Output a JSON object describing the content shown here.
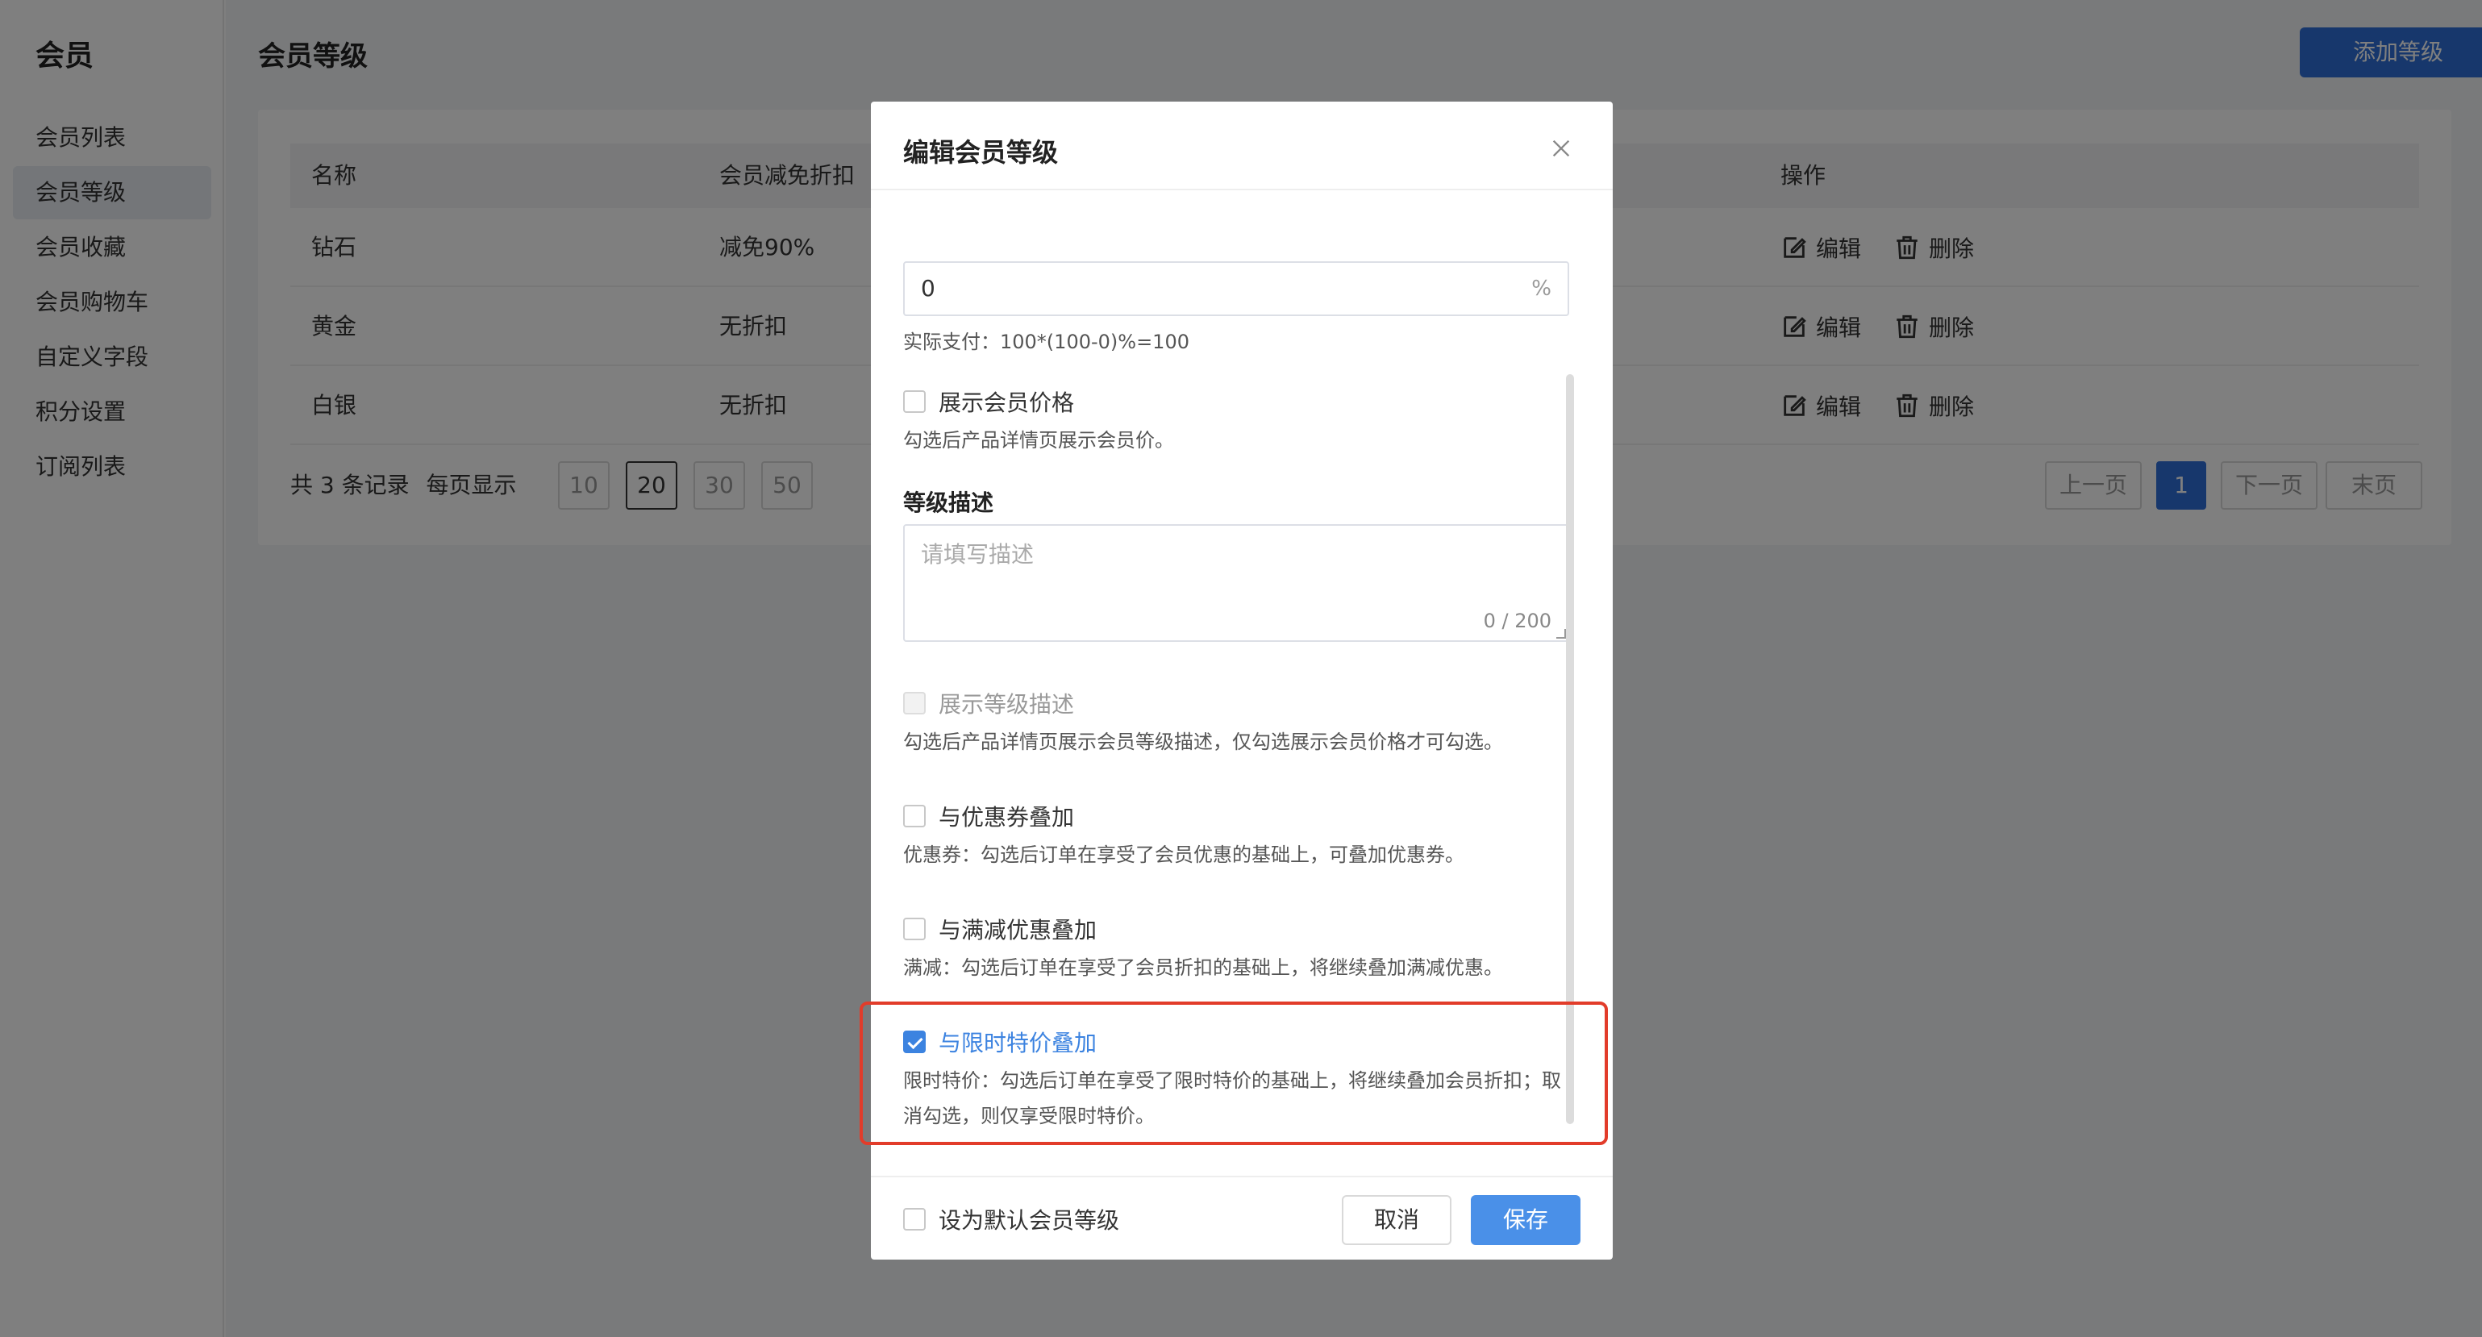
{
  "sidebar": {
    "title": "会员",
    "items": [
      {
        "label": "会员列表"
      },
      {
        "label": "会员等级",
        "active": true
      },
      {
        "label": "会员收藏"
      },
      {
        "label": "会员购物车"
      },
      {
        "label": "自定义字段"
      },
      {
        "label": "积分设置"
      },
      {
        "label": "订阅列表"
      }
    ]
  },
  "header": {
    "title": "会员等级",
    "add_button": "添加等级"
  },
  "table": {
    "columns": [
      "名称",
      "会员减免折扣",
      "操作"
    ],
    "rows": [
      {
        "name": "钻石",
        "discount": "减免90%"
      },
      {
        "name": "黄金",
        "discount": "无折扣"
      },
      {
        "name": "白银",
        "discount": "无折扣"
      }
    ],
    "edit_label": "编辑",
    "delete_label": "删除"
  },
  "pagination": {
    "total_text": "共 3 条记录",
    "per_page_label": "每页显示",
    "sizes": [
      "10",
      "20",
      "30",
      "50"
    ],
    "selected_size": "20",
    "prev": "上一页",
    "current_page": "1",
    "next": "下一页",
    "last": "末页"
  },
  "modal": {
    "title": "编辑会员等级",
    "discount_input": {
      "value": "0",
      "suffix": "%",
      "hint": "实际支付：100*(100-0)%=100"
    },
    "show_member_price": {
      "label": "展示会员价格",
      "checked": false,
      "hint": "勾选后产品详情页展示会员价。"
    },
    "description": {
      "title": "等级描述",
      "placeholder": "请填写描述",
      "counter": "0 / 200"
    },
    "show_description": {
      "label": "展示等级描述",
      "disabled": true,
      "hint": "勾选后产品详情页展示会员等级描述，仅勾选展示会员价格才可勾选。"
    },
    "coupon_stack": {
      "label": "与优惠券叠加",
      "checked": false,
      "hint": "优惠券：勾选后订单在享受了会员优惠的基础上，可叠加优惠券。"
    },
    "full_reduction_stack": {
      "label": "与满减优惠叠加",
      "checked": false,
      "hint": "满减：勾选后订单在享受了会员折扣的基础上，将继续叠加满减优惠。"
    },
    "flash_sale_stack": {
      "label": "与限时特价叠加",
      "checked": true,
      "hint_line1": "限时特价：勾选后订单在享受了限时特价的基础上，将继续叠加会员折扣；取",
      "hint_line2": "消勾选，则仅享受限时特价。"
    },
    "default_level": {
      "label": "设为默认会员等级",
      "checked": false
    },
    "cancel": "取消",
    "save": "保存"
  },
  "colors": {
    "primary": "#2f6fd9",
    "checked": "#3c83e0",
    "highlight": "#e23c2a"
  }
}
